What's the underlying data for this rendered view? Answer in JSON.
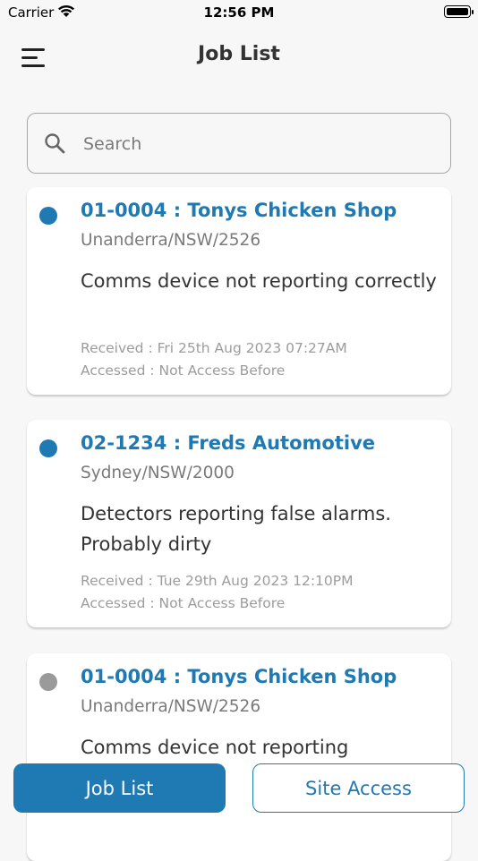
{
  "status_bar": {
    "carrier": "Carrier",
    "time": "12:56 PM"
  },
  "header": {
    "title": "Job List"
  },
  "search": {
    "placeholder": "Search",
    "value": ""
  },
  "jobs": [
    {
      "title": "01-0004 : Tonys Chicken Shop",
      "location": "Unanderra/NSW/2526",
      "description": "Comms device not reporting correctly",
      "received": "Received : Fri 25th Aug 2023 07:27AM",
      "accessed": "Accessed : Not Access Before",
      "status_color": "#1f79b2"
    },
    {
      "title": "02-1234 : Freds Automotive",
      "location": "Sydney/NSW/2000",
      "description": "Detectors reporting false alarms. Probably dirty",
      "received": "Received : Tue 29th Aug 2023 12:10PM",
      "accessed": "Accessed : Not Access Before",
      "status_color": "#1f79b2"
    },
    {
      "title": "01-0004 : Tonys Chicken Shop",
      "location": "Unanderra/NSW/2526",
      "description": "Comms device not reporting",
      "status_color": "#9a9a9a"
    }
  ],
  "bottom_nav": {
    "job_list_label": "Job List",
    "site_access_label": "Site Access"
  },
  "colors": {
    "accent": "#1f79b2",
    "background": "#f7f7f7",
    "inactive_dot": "#9a9a9a"
  }
}
